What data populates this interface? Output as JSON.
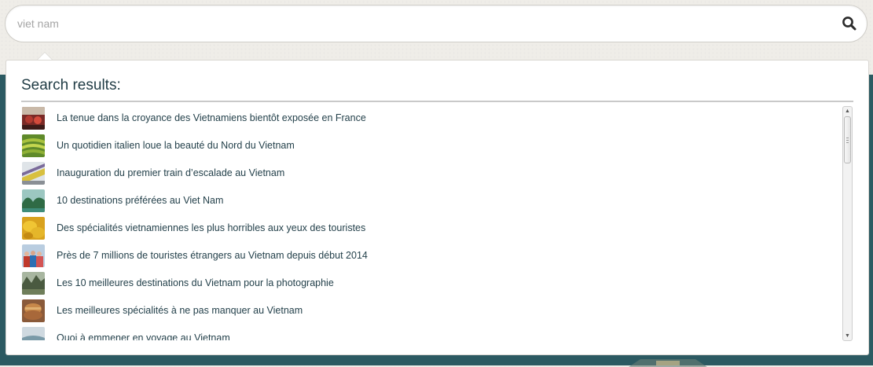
{
  "search": {
    "value": "viet nam",
    "icon": "search-icon"
  },
  "results_panel": {
    "title": "Search results:",
    "items": [
      {
        "title": "La tenue dans la croyance des Vietnamiens bientôt exposée en France"
      },
      {
        "title": "Un quotidien italien loue la beauté du Nord du Vietnam"
      },
      {
        "title": "Inauguration du premier train d’escalade au Vietnam"
      },
      {
        "title": "10 destinations préférées au Viet Nam"
      },
      {
        "title": "Des spécialités vietnamiennes les plus horribles aux yeux des touristes"
      },
      {
        "title": "Près de 7 millions de touristes étrangers au Vietnam depuis début 2014"
      },
      {
        "title": "Les 10 meilleures destinations du Vietnam pour la photographie"
      },
      {
        "title": "Les meilleures spécialités à ne pas manquer au Vietnam"
      },
      {
        "title": "Quoi à emmener en voyage au Vietnam"
      }
    ]
  },
  "colors": {
    "teal_band": "#2c5a62",
    "title_text": "#1f3b44",
    "result_text": "#24414b"
  }
}
